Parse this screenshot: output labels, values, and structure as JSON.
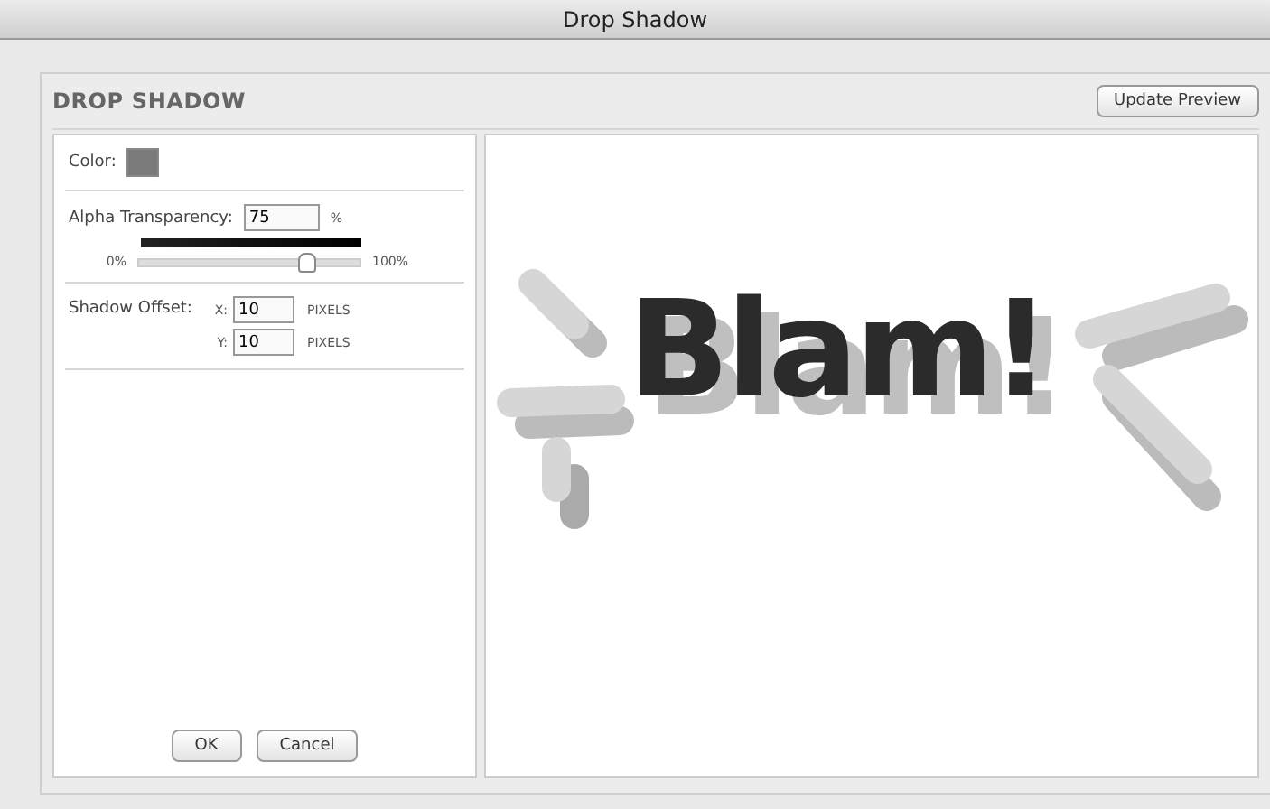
{
  "window": {
    "title": "Drop Shadow"
  },
  "header": {
    "title": "DROP SHADOW",
    "button": "Update Preview"
  },
  "color": {
    "label": "Color:"
  },
  "alpha": {
    "label": "Alpha Transparency:",
    "value": "75",
    "unit": "%",
    "min_label": "0%",
    "max_label": "100%",
    "level": 0.75
  },
  "offset": {
    "label": "Shadow Offset:",
    "fields": [
      {
        "axis": "X:",
        "value": "10",
        "unit": "PIXELS"
      },
      {
        "axis": "Y:",
        "value": "10",
        "unit": "PIXELS"
      }
    ]
  },
  "buttons": [
    "OK",
    "Cancel"
  ],
  "preview": {
    "text": "Blam!"
  }
}
